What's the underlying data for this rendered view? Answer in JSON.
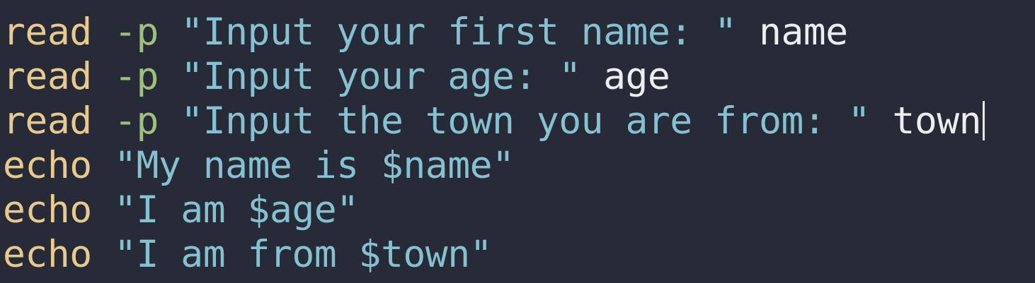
{
  "editor": {
    "lines": [
      {
        "cmd": "read",
        "flag": "-p",
        "str": "\"Input your first name: \"",
        "var": "name"
      },
      {
        "cmd": "read",
        "flag": "-p",
        "str": "\"Input your age: \"",
        "var": "age"
      },
      {
        "cmd": "read",
        "flag": "-p",
        "str": "\"Input the town you are from: \"",
        "var": "town"
      },
      {
        "cmd": "echo",
        "str": "\"My name is $name\""
      },
      {
        "cmd": "echo",
        "str": "\"I am $age\""
      },
      {
        "cmd": "echo",
        "str": "\"I am from $town\""
      }
    ]
  },
  "colors": {
    "background": "#272b38",
    "keyword": "#e9c98c",
    "flag": "#9ec07a",
    "string": "#85c1d1",
    "variable": "#eceef2"
  }
}
